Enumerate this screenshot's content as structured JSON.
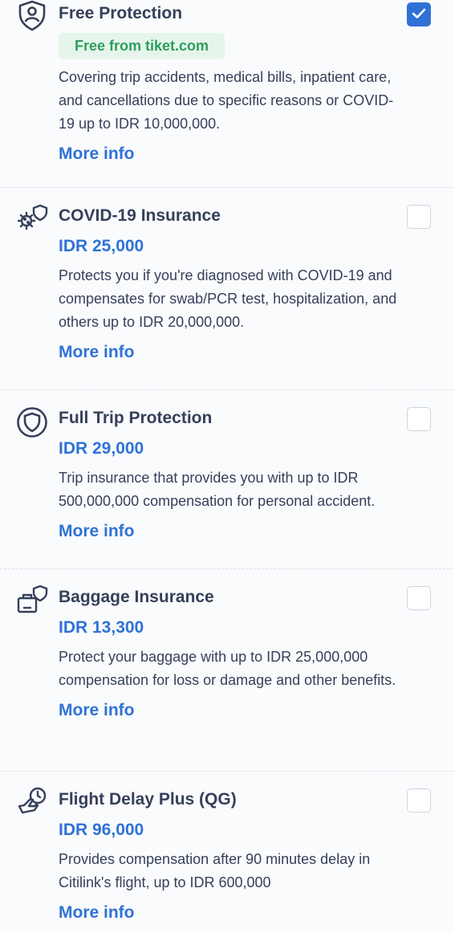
{
  "items": [
    {
      "title": "Free Protection",
      "badge": "Free from tiket.com",
      "description": "Covering trip accidents, medical bills, inpatient care, and cancellations due to specific reasons or COVID-19 up to IDR 10,000,000.",
      "more": "More info",
      "checked": true,
      "icon": "person-shield-icon"
    },
    {
      "title": "COVID-19 Insurance",
      "price": "IDR 25,000",
      "description": "Protects you if you're diagnosed with COVID-19 and compensates for swab/PCR test, hospitalization, and others up to IDR 20,000,000.",
      "more": "More info",
      "checked": false,
      "icon": "virus-shield-icon"
    },
    {
      "title": "Full Trip Protection",
      "price": "IDR 29,000",
      "description": "Trip insurance that provides you with up to IDR 500,000,000 compensation for personal accident.",
      "more": "More info",
      "checked": false,
      "icon": "shield-icon"
    },
    {
      "title": "Baggage Insurance",
      "price": "IDR 13,300",
      "description": "Protect your baggage with up to IDR 25,000,000 compensation for loss or damage and other benefits.",
      "more": "More info",
      "checked": false,
      "icon": "baggage-shield-icon"
    },
    {
      "title": "Flight Delay Plus (QG)",
      "price": "IDR 96,000",
      "description": "Provides compensation after 90 minutes delay in Citilink's flight, up to IDR 600,000",
      "more": "More info",
      "checked": false,
      "icon": "plane-clock-icon"
    }
  ]
}
